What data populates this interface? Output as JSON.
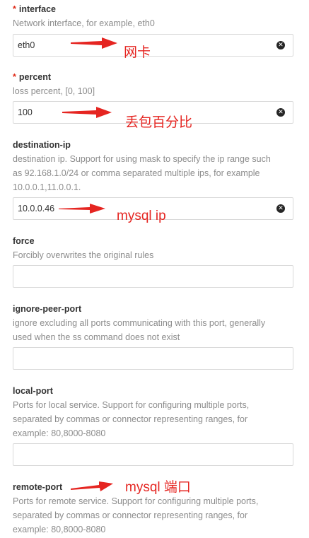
{
  "fields": [
    {
      "label": "interface",
      "required": "*",
      "help": "Network interface, for example, eth0",
      "value": "eth0"
    },
    {
      "label": "percent",
      "required": "*",
      "help": "loss percent, [0, 100]",
      "value": "100"
    },
    {
      "label": "destination-ip",
      "help_lines": [
        "destination ip. Support for using mask to specify the ip range such",
        "as 92.168.1.0/24 or comma separated multiple ips, for example",
        "10.0.0.1,11.0.0.1."
      ],
      "value": "10.0.0.46"
    },
    {
      "label": "force",
      "help": "Forcibly overwrites the original rules",
      "value": ""
    },
    {
      "label": "ignore-peer-port",
      "help_lines": [
        "ignore excluding all ports communicating with this port, generally",
        "used when the ss command does not exist"
      ],
      "value": ""
    },
    {
      "label": "local-port",
      "help_lines": [
        "Ports for local service. Support for configuring multiple ports,",
        "separated by commas or connector representing ranges, for",
        "example: 80,8000-8080"
      ],
      "value": ""
    },
    {
      "label": "remote-port",
      "help_lines": [
        "Ports for remote service. Support for configuring multiple ports,",
        "separated by commas or connector representing ranges, for",
        "example: 80,8000-8080"
      ]
    }
  ],
  "annotations": {
    "interface": "网卡",
    "percent": "丢包百分比",
    "destination_ip": "mysql ip",
    "remote_port": "mysql 端口"
  },
  "colors": {
    "required": "#e0301e",
    "annotation": "#e52521",
    "help_text": "#8c8c8c",
    "input_border": "#d9d9d9"
  },
  "icons": {
    "clear": "close-circle-icon",
    "annotation_arrow": "arrow-right-icon"
  }
}
